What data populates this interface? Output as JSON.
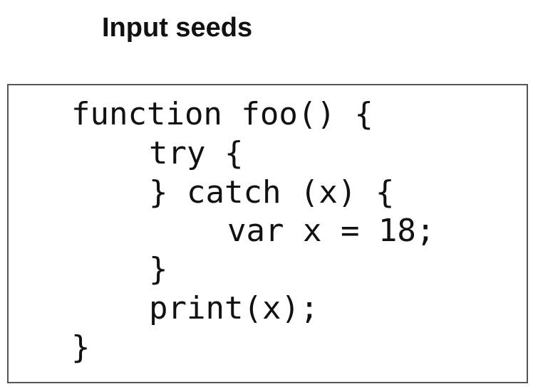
{
  "title": "Input seeds",
  "code": {
    "lines": [
      "function foo() {",
      "try {",
      "} catch (x) {",
      "var x = 18;",
      "}",
      "print(x);",
      "}"
    ]
  }
}
